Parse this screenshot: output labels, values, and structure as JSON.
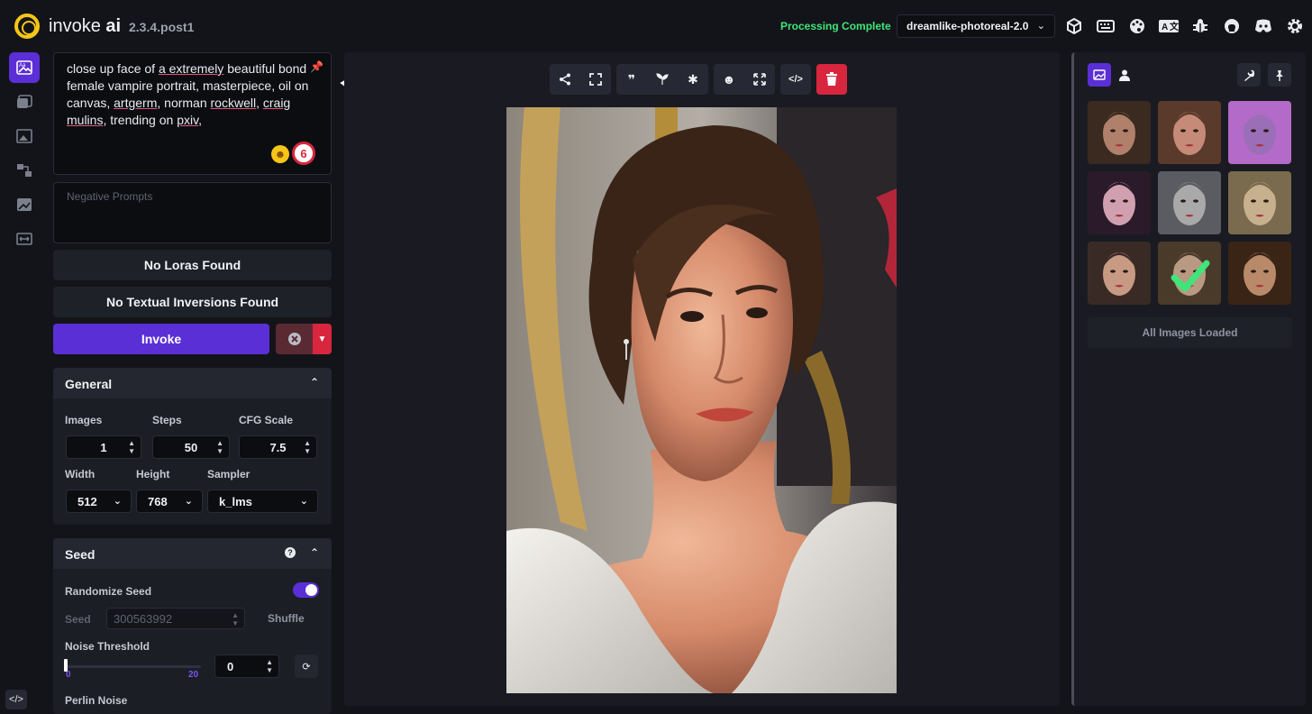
{
  "header": {
    "brand_name": "invoke",
    "brand_suffix": "ai",
    "version": "2.3.4.post1",
    "status": "Processing Complete",
    "model": "dreamlike-photoreal-2.0",
    "icons": [
      "cube-icon",
      "keyboard-icon",
      "palette-icon",
      "translate-icon",
      "bug-icon",
      "github-icon",
      "discord-icon",
      "gear-icon"
    ]
  },
  "rail": {
    "items": [
      "text-to-image-icon",
      "image-to-image-icon",
      "unified-canvas-icon",
      "nodes-icon",
      "postprocessing-icon",
      "training-icon"
    ],
    "bottom_label": "</>"
  },
  "prompt": {
    "segments": [
      {
        "t": "close up face of ",
        "u": false
      },
      {
        "t": "a extremely",
        "u": true
      },
      {
        "t": " beautiful bond female vampire portrait, masterpiece, oil on canvas, ",
        "u": false
      },
      {
        "t": "artgerm",
        "u": true
      },
      {
        "t": ", norman ",
        "u": false
      },
      {
        "t": "rockwell",
        "u": true
      },
      {
        "t": ", ",
        "u": false
      },
      {
        "t": "craig",
        "u": true
      },
      {
        "t": " ",
        "u": false
      },
      {
        "t": "mulins",
        "u": true
      },
      {
        "t": ", trending on ",
        "u": false
      },
      {
        "t": "pxiv",
        "u": true
      },
      {
        "t": ",",
        "u": false
      }
    ],
    "grammarly_badge": "6",
    "negative_placeholder": "Negative Prompts"
  },
  "loras_label": "No Loras Found",
  "ti_label": "No Textual Inversions Found",
  "invoke_label": "Invoke",
  "general": {
    "title": "General",
    "images_label": "Images",
    "images_value": "1",
    "steps_label": "Steps",
    "steps_value": "50",
    "cfg_label": "CFG Scale",
    "cfg_value": "7.5",
    "width_label": "Width",
    "width_value": "512",
    "height_label": "Height",
    "height_value": "768",
    "sampler_label": "Sampler",
    "sampler_value": "k_lms"
  },
  "seed": {
    "title": "Seed",
    "randomize_label": "Randomize Seed",
    "randomize_on": true,
    "seed_label": "Seed",
    "seed_value": "300563992",
    "shuffle_label": "Shuffle",
    "noise_label": "Noise Threshold",
    "noise_min": "0",
    "noise_max": "20",
    "noise_value": "0",
    "perlin_label": "Perlin Noise"
  },
  "toolbar": {
    "groups": [
      [
        "share-icon",
        "fullscreen-icon"
      ],
      [
        "quote-icon",
        "seedling-icon",
        "asterisk-icon"
      ],
      [
        "face-icon",
        "expand-icon"
      ],
      [
        "code-icon"
      ],
      [
        "trash-icon"
      ]
    ]
  },
  "gallery": {
    "tabs": [
      "images-tab-icon",
      "user-tab-icon"
    ],
    "tools": [
      "wrench-icon",
      "pin-icon"
    ],
    "status": "All Images Loaded",
    "thumbnails": [
      {
        "tone": "#b0806a",
        "hair": "#3a2a20"
      },
      {
        "tone": "#c58a78",
        "hair": "#5a3a2a"
      },
      {
        "tone": "#9a6fb8",
        "hair": "#b46ac8"
      },
      {
        "tone": "#d0a0b0",
        "hair": "#2a1a2a"
      },
      {
        "tone": "#a9a9aa",
        "hair": "#5b5b62"
      },
      {
        "tone": "#c7b08e",
        "hair": "#7a6a4e"
      },
      {
        "tone": "#c79a84",
        "hair": "#3a2a26"
      },
      {
        "tone": "#b89a82",
        "hair": "#4a3a2a"
      },
      {
        "tone": "#b88a6a",
        "hair": "#3a2416"
      }
    ],
    "selected_index": 7
  },
  "colors": {
    "accent": "#5b2fd6",
    "danger": "#d7263d",
    "success": "#3ee57a",
    "panel": "#1c1e26",
    "bg": "#131419"
  }
}
